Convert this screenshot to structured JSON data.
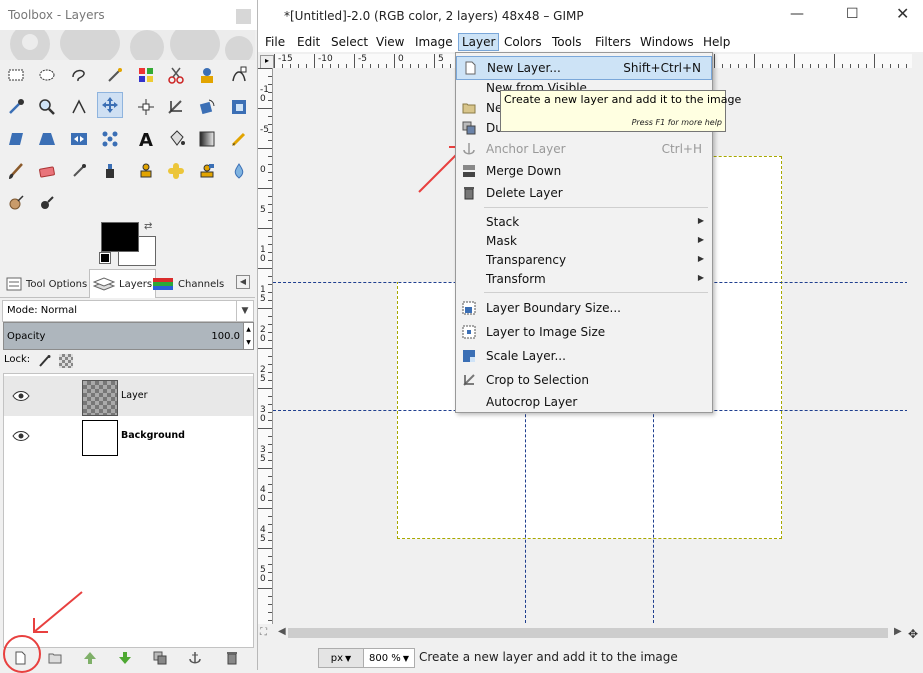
{
  "toolbox": {
    "title": "Toolbox - Layers",
    "tabs": [
      {
        "label": "Tool Options"
      },
      {
        "label": "Layers"
      },
      {
        "label": "Channels"
      }
    ],
    "mode_label": "Mode: Normal",
    "opacity_label": "Opacity",
    "opacity_value": "100.0",
    "lock_label": "Lock:",
    "layers": [
      {
        "name": "Layer",
        "visible": true,
        "selected": true
      },
      {
        "name": "Background",
        "visible": true,
        "selected": false
      }
    ]
  },
  "image_window": {
    "title": "*[Untitled]-2.0 (RGB color, 2 layers) 48x48 – GIMP",
    "menus": [
      "File",
      "Edit",
      "Select",
      "View",
      "Image",
      "Layer",
      "Colors",
      "Tools",
      "Filters",
      "Windows",
      "Help"
    ],
    "open_menu": "Layer",
    "hruler_labels": [
      "-15",
      "-10",
      "-5",
      "0",
      "5"
    ],
    "vruler_labels": [
      "-1 0",
      "-5",
      "0",
      "5",
      "1 0",
      "1 5",
      "2 0",
      "2 5",
      "3 0",
      "3 5",
      "4 0",
      "4 5",
      "5 0"
    ],
    "status": {
      "unit": "px",
      "zoom": "800 %",
      "message": "Create a new layer and add it to the image"
    }
  },
  "layer_menu": {
    "items": [
      {
        "label": "New Layer...",
        "shortcut": "Shift+Ctrl+N",
        "highlighted": true,
        "icon": "new-layer-icon"
      },
      {
        "label": "New from Visible",
        "icon": ""
      },
      {
        "label": "Ne",
        "icon": "folder-icon"
      },
      {
        "label": "Du",
        "icon": "duplicate-icon"
      },
      {
        "label": "Anchor Layer",
        "shortcut": "Ctrl+H",
        "disabled": true,
        "icon": "anchor-icon"
      },
      {
        "label": "Merge Down",
        "icon": "merge-icon"
      },
      {
        "label": "Delete Layer",
        "icon": "delete-icon"
      },
      {
        "label": "Stack",
        "submenu": true
      },
      {
        "label": "Mask",
        "submenu": true
      },
      {
        "label": "Transparency",
        "submenu": true
      },
      {
        "label": "Transform",
        "submenu": true
      },
      {
        "label": "Layer Boundary Size...",
        "icon": "layer-boundary-icon"
      },
      {
        "label": "Layer to Image Size",
        "icon": "layer-to-image-icon"
      },
      {
        "label": "Scale Layer...",
        "icon": "scale-layer-icon"
      },
      {
        "label": "Crop to Selection",
        "icon": "crop-icon"
      },
      {
        "label": "Autocrop Layer",
        "icon": ""
      }
    ]
  },
  "tooltip": {
    "text": "Create a new layer and add it to the image",
    "help": "Press F1 for more help"
  },
  "colors": {
    "accent": "#cde3f6",
    "annotation": "#e8403f",
    "guide": "#1f3f8f",
    "selection": "#a8a800"
  }
}
